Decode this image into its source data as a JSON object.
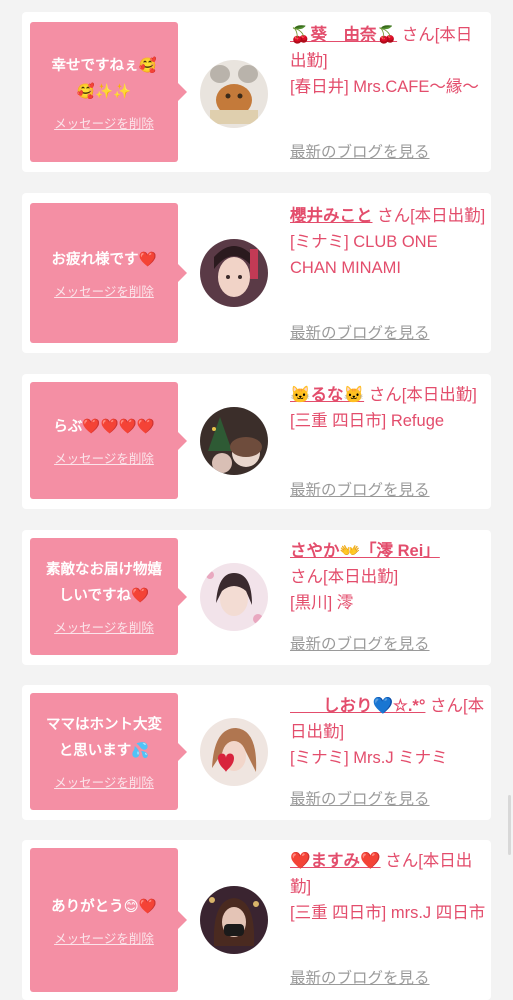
{
  "delete_label": "メッセージを削除",
  "blog_label": "最新のブログを見る",
  "colors": {
    "accent": "#e34d6c",
    "bubble": "#f48fa4",
    "background": "#f3f3f3"
  },
  "cards": [
    {
      "message_line1": "幸せですねぇ🥰",
      "message_line2": "🥰✨✨",
      "name": "🍒葵　由奈🍒",
      "suffix": "さん[本日出勤]",
      "shop": "[春日井] Mrs.CAFE〜縁〜"
    },
    {
      "message_line1": "お疲れ様です❤️",
      "message_line2": "",
      "name": "櫻井みこと",
      "suffix": "さん[本日出勤]",
      "shop": "[ミナミ] CLUB ONE CHAN MINAMI"
    },
    {
      "message_line1": "らぶ❤️❤️❤️❤️",
      "message_line2": "",
      "name": "🐱るな🐱",
      "suffix": "さん[本日出勤]",
      "shop": "[三重 四日市] Refuge"
    },
    {
      "message_line1": "素敵なお届け物嬉",
      "message_line2": "しいですね❤️",
      "name": "さやか👐「澪 Rei」",
      "suffix": "さん[本日出勤]",
      "shop": "[黒川] 澪"
    },
    {
      "message_line1": "ママはホント大変",
      "message_line2": "と思います💦",
      "name": "　　しおり💙☆.*°",
      "suffix": "さん[本日出勤]",
      "shop": "[ミナミ] Mrs.J ミナミ"
    },
    {
      "message_line1": "ありがとう😊❤️",
      "message_line2": "",
      "name": "❤️ますみ❤️",
      "suffix": "さん[本日出勤]",
      "shop": "[三重 四日市] mrs.J 四日市"
    }
  ]
}
